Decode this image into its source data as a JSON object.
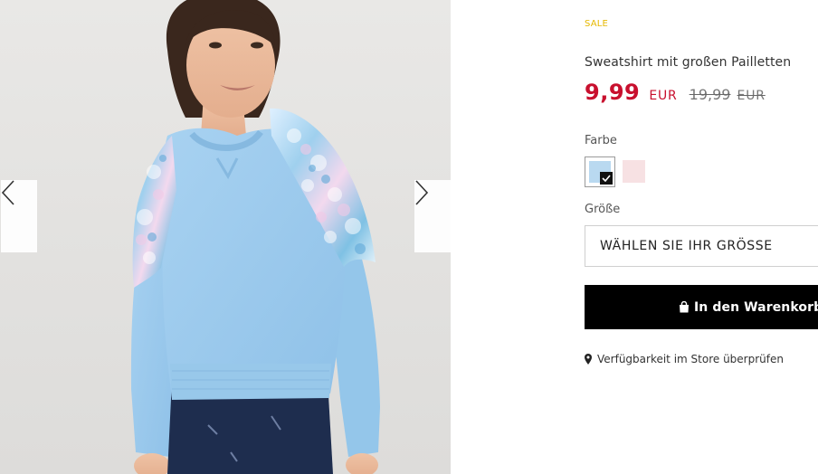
{
  "gallery": {
    "image_alt": "Mädchen im hellblauen Sweatshirt mit großen Pailletten",
    "prev_icon": "chevron-left-icon",
    "next_icon": "chevron-right-icon"
  },
  "product": {
    "badge": "SALE",
    "title": "Sweatshirt mit großen Pailletten",
    "price_new": "9,99",
    "currency_new": "EUR",
    "price_old": "19,99",
    "currency_old": "EUR"
  },
  "color": {
    "label": "Farbe",
    "swatches": [
      {
        "name": "hellblau",
        "hex": "#b9d9f0",
        "selected": true
      },
      {
        "name": "rosa",
        "hex": "#f7e1e3",
        "selected": false
      }
    ]
  },
  "size": {
    "label": "Größe",
    "placeholder": "WÄHLEN SIE IHR GRÖSSE"
  },
  "cart": {
    "label": "In den Warenkorb",
    "icon": "shopping-bag-icon"
  },
  "store": {
    "label": "Verfügbarkeit im Store überprüfen",
    "icon": "map-pin-icon"
  },
  "colors": {
    "sale": "#e6b800",
    "price": "#c8102e",
    "button": "#000000"
  }
}
